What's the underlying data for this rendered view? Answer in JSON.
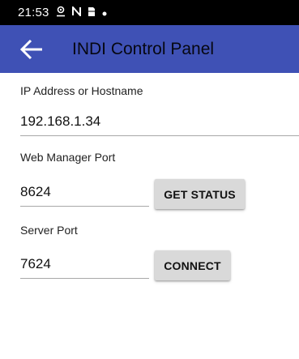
{
  "status_bar": {
    "time": "21:53",
    "icons": [
      "location-icon",
      "nfc-icon",
      "sim-card-icon",
      "notification-dot-icon"
    ]
  },
  "app_bar": {
    "title": "INDI Control Panel",
    "background": "#3f51b5"
  },
  "form": {
    "ip_label": "IP Address or Hostname",
    "ip_value": "192.168.1.34",
    "web_port_label": "Web Manager Port",
    "web_port_value": "8624",
    "get_status_label": "GET STATUS",
    "server_port_label": "Server Port",
    "server_port_value": "7624",
    "connect_label": "CONNECT"
  }
}
